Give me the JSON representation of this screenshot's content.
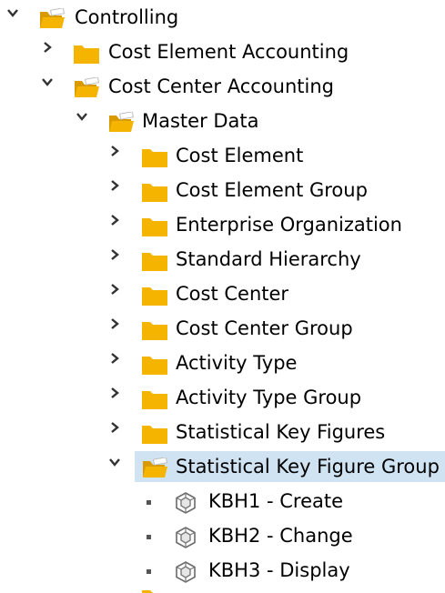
{
  "tree": {
    "root": {
      "label": "Controlling",
      "icon": "folder-open-icon",
      "expanded": true
    },
    "cost_element_accounting": {
      "label": "Cost Element Accounting",
      "icon": "folder-icon",
      "expanded": false
    },
    "cost_center_accounting": {
      "label": "Cost Center Accounting",
      "icon": "folder-open-icon",
      "expanded": true
    },
    "master_data": {
      "label": "Master Data",
      "icon": "folder-open-icon",
      "expanded": true
    },
    "master_items": [
      {
        "label": "Cost Element",
        "icon": "folder-icon"
      },
      {
        "label": "Cost Element Group",
        "icon": "folder-icon"
      },
      {
        "label": "Enterprise Organization",
        "icon": "folder-icon"
      },
      {
        "label": "Standard Hierarchy",
        "icon": "folder-icon"
      },
      {
        "label": "Cost Center",
        "icon": "folder-icon"
      },
      {
        "label": "Cost Center Group",
        "icon": "folder-icon"
      },
      {
        "label": "Activity Type",
        "icon": "folder-icon"
      },
      {
        "label": "Activity Type Group",
        "icon": "folder-icon"
      },
      {
        "label": "Statistical Key Figures",
        "icon": "folder-icon"
      }
    ],
    "selected_folder": {
      "label": "Statistical Key Figure Group",
      "icon": "folder-open-icon",
      "expanded": true,
      "selected": true
    },
    "transactions": [
      {
        "label": "KBH1 - Create",
        "icon": "transaction-cube-icon"
      },
      {
        "label": "KBH2 - Change",
        "icon": "transaction-cube-icon"
      },
      {
        "label": "KBH3 - Display",
        "icon": "transaction-cube-icon"
      }
    ]
  },
  "colors": {
    "folder": "#f5b400",
    "folder_dark": "#d99a00",
    "selection": "#cfe3f2",
    "arrow": "#333333"
  }
}
